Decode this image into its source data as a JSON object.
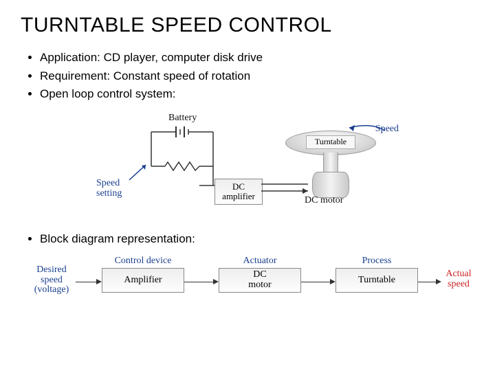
{
  "title": "TURNTABLE SPEED CONTROL",
  "bullets": {
    "b1": "Application: CD player, computer disk drive",
    "b2": "Requirement: Constant speed of rotation",
    "b3": "Open loop control system:",
    "b4": "Block diagram representation:"
  },
  "fig1": {
    "battery_label": "Battery",
    "speed_label": "Speed",
    "speed_setting_label": "Speed\nsetting",
    "dc_amp_label": "DC\namplifier",
    "turntable_label": "Turntable",
    "dc_motor_label": "DC motor"
  },
  "fig2": {
    "input_label": "Desired\nspeed\n(voltage)",
    "output_label": "Actual\nspeed",
    "blocks": [
      {
        "caption": "Control device",
        "box": "Amplifier"
      },
      {
        "caption": "Actuator",
        "box": "DC\nmotor"
      },
      {
        "caption": "Process",
        "box": "Turntable"
      }
    ]
  }
}
